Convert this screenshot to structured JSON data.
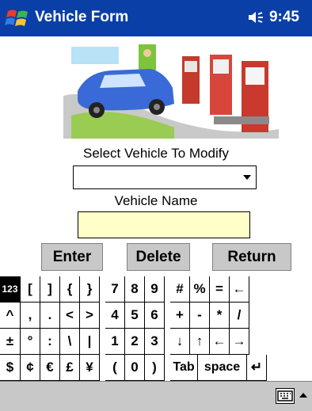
{
  "titlebar": {
    "title": "Vehicle Form",
    "time": "9:45",
    "start_icon": "windows-flag-icon",
    "volume_icon": "speaker-icon"
  },
  "form": {
    "select_label": "Select Vehicle To Modify",
    "select_value": "",
    "name_label": "Vehicle Name",
    "name_value": ""
  },
  "buttons": {
    "enter": "Enter",
    "delete": "Delete",
    "return": "Return"
  },
  "keyboard": {
    "rows": [
      [
        "123",
        "[",
        "]",
        "{",
        "}",
        "7",
        "8",
        "9",
        "#",
        "%",
        "=",
        "←"
      ],
      [
        "^",
        ",",
        ".",
        "<",
        ">",
        "4",
        "5",
        "6",
        "+",
        "-",
        "*",
        "/"
      ],
      [
        "±",
        "°",
        ":",
        "\\",
        "|",
        "1",
        "2",
        "3",
        "↓",
        "↑",
        "←",
        "→"
      ],
      [
        "$",
        "¢",
        "€",
        "£",
        "¥",
        "(",
        "0",
        ")",
        "Tab",
        "space",
        "↵"
      ]
    ]
  },
  "bottombar": {
    "sip_icon": "keyboard-icon",
    "sip_menu_icon": "up-arrow-icon"
  }
}
